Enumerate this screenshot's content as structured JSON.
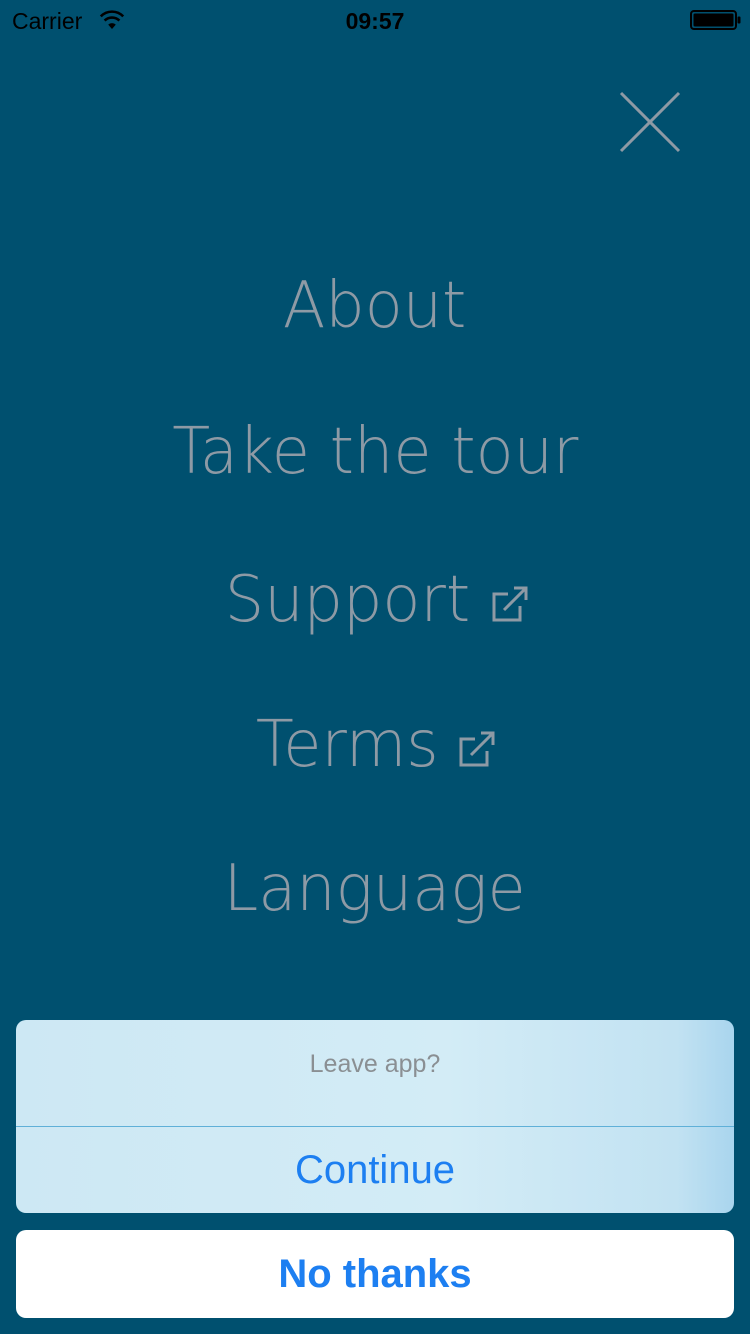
{
  "status_bar": {
    "carrier": "Carrier",
    "time": "09:57",
    "icons": [
      "wifi-icon",
      "battery-icon"
    ]
  },
  "close_icon": "close-icon",
  "menu": {
    "items": [
      {
        "label": "About",
        "external": false
      },
      {
        "label": "Take the tour",
        "external": false
      },
      {
        "label": "Support",
        "external": true,
        "icon": "external-link-icon"
      },
      {
        "label": "Terms",
        "external": true,
        "icon": "external-link-icon"
      },
      {
        "label": "Language",
        "external": false
      }
    ]
  },
  "action_sheet": {
    "title": "Leave app?",
    "continue_label": "Continue",
    "cancel_label": "No thanks"
  },
  "colors": {
    "background": "#00506f",
    "menu_text": "#8e9aa5",
    "accent": "#1d7ff1"
  }
}
